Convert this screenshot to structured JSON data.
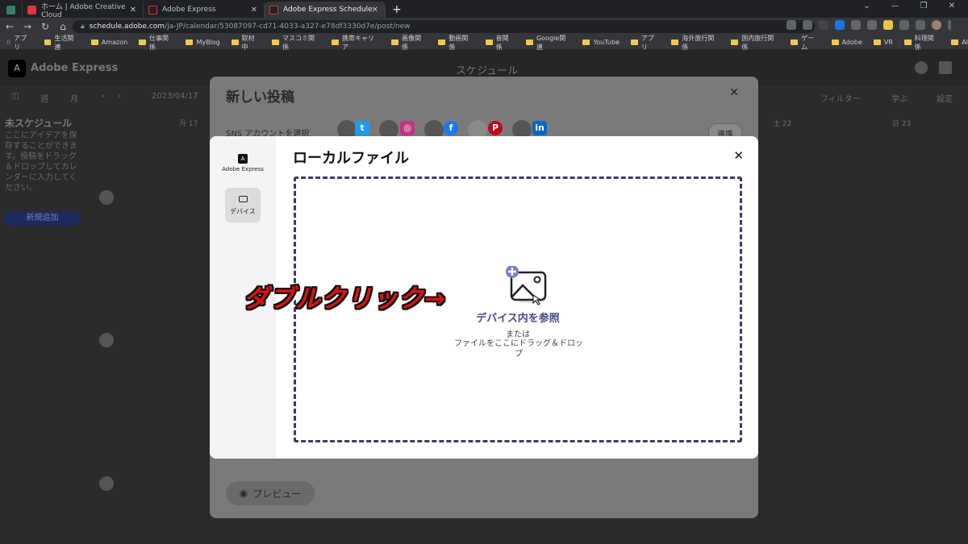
{
  "browser": {
    "tabs": [
      {
        "title": "ホーム | Adobe Creative Cloud",
        "color": "#e2343d"
      },
      {
        "title": "Adobe Express",
        "color": "#e2343d"
      },
      {
        "title": "Adobe Express Schedule",
        "color": "#e2343d"
      }
    ],
    "url_host": "schedule.adobe.com",
    "url_path": "/ja-JP/calendar/53087097-cd71-4033-a327-e78df3330d7e/post/new",
    "bookmarks": [
      "アプリ",
      "生活関連",
      "Amazon",
      "仕事関係",
      "MyBlog",
      "取材中",
      "マスコミ関係",
      "携帯キャリア",
      "画像関係",
      "動画関係",
      "音関係",
      "Google関連",
      "YouTube",
      "アプリ",
      "海外旅行関係",
      "国内旅行関係",
      "ゲーム",
      "Adobe",
      "VR",
      "料理関係",
      "AI"
    ]
  },
  "app": {
    "logo_text": "Adobe Express",
    "page_title": "スケジュール",
    "toolbar": {
      "week": "週",
      "month": "月",
      "date": "2023/04/17",
      "filter": "フィルター",
      "learn": "学ぶ",
      "settings": "設定"
    },
    "days": [
      "月 17",
      "土 22",
      "日 23"
    ],
    "sidebar": {
      "title": "未スケジュール",
      "text": "ここにアイデアを保存することができます。投稿をドラッグ＆ドロップしてカレンダーに入力してください。",
      "new_button": "新規追加"
    }
  },
  "post_modal": {
    "title": "新しい投稿",
    "sns_label": "SNS アカウントを選択",
    "connect": "連携",
    "preview": "プレビュー"
  },
  "file_modal": {
    "brand": "Adobe Express",
    "device_tab": "デバイス",
    "title": "ローカルファイル",
    "browse": "デバイス内を参照",
    "or": "または",
    "drop_hint": "ファイルをここにドラッグ＆ドロップ"
  },
  "annotation": "ダブルクリック→",
  "colors": {
    "accent": "#3b3a6e",
    "annotation": "#e01010"
  }
}
